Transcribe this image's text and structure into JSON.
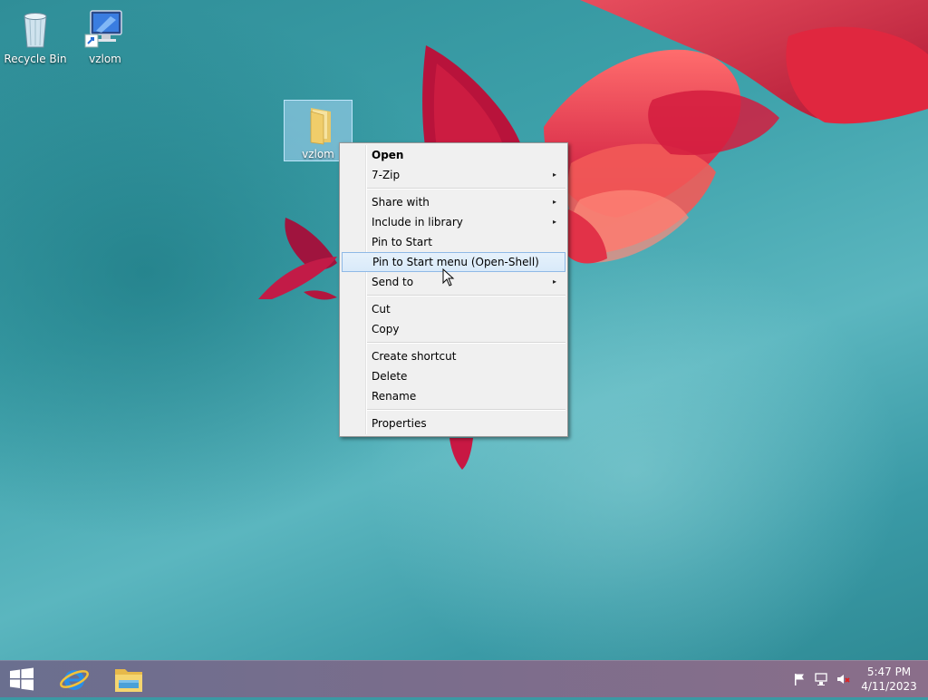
{
  "desktop": {
    "icons": [
      {
        "label": "Recycle Bin"
      },
      {
        "label": "vzlom"
      }
    ],
    "selected_folder": {
      "label": "vzlom"
    }
  },
  "context_menu": {
    "items": [
      {
        "label": "Open"
      },
      {
        "label": "7-Zip"
      },
      {
        "label": "Share with"
      },
      {
        "label": "Include in library"
      },
      {
        "label": "Pin to Start"
      },
      {
        "label": "Pin to Start menu (Open-Shell)"
      },
      {
        "label": "Send to"
      },
      {
        "label": "Cut"
      },
      {
        "label": "Copy"
      },
      {
        "label": "Create shortcut"
      },
      {
        "label": "Delete"
      },
      {
        "label": "Rename"
      },
      {
        "label": "Properties"
      }
    ],
    "submenu_arrow": "▸",
    "hovered_item": "Pin to Start menu (Open-Shell)"
  },
  "taskbar": {
    "pinned": [
      "windows-start-icon",
      "internet-explorer-icon",
      "file-explorer-icon"
    ],
    "tray_icons": [
      "action-center-flag-icon",
      "network-icon",
      "volume-muted-icon"
    ],
    "time": "5:47 PM",
    "date": "4/11/2023"
  },
  "colors": {
    "wallpaper_teal": "#3a9aa4",
    "flower_red": "#d8203c",
    "menu_hover_border": "#8fb9e6",
    "taskbar": "#7a6d8c"
  }
}
